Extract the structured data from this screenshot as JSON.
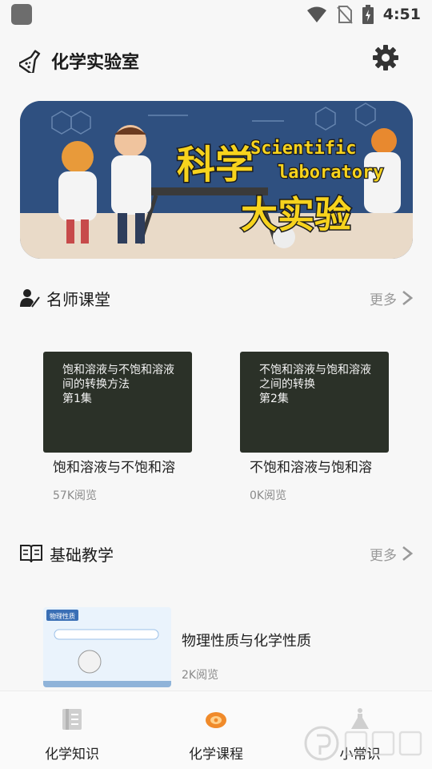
{
  "status_bar": {
    "time": "4:51"
  },
  "header": {
    "title": "化学实验室",
    "logo_icon": "flask-icon",
    "settings_icon": "gear-icon"
  },
  "banner": {
    "line1": "科学",
    "line2": "大实验",
    "en_line1": "Scientific",
    "en_line2": "laboratory"
  },
  "teacher_section": {
    "title": "名师课堂",
    "more": "更多",
    "videos": [
      {
        "thumb_text": "饱和溶液与不饱和溶液间的转换方法",
        "thumb_episode": "第1集",
        "title": "饱和溶液与不饱和溶",
        "views": "57K阅览"
      },
      {
        "thumb_text": "不饱和溶液与饱和溶液之间的转换",
        "thumb_episode": "第2集",
        "title": "不饱和溶液与饱和溶",
        "views": "0K阅览"
      }
    ]
  },
  "basic_section": {
    "title": "基础教学",
    "more": "更多",
    "lessons": [
      {
        "thumb_label": "物理性质",
        "title": "物理性质与化学性质",
        "views": "2K阅览"
      }
    ]
  },
  "bottom_nav": [
    {
      "label": "化学知识",
      "icon": "book-icon"
    },
    {
      "label": "化学课程",
      "icon": "course-icon"
    },
    {
      "label": "小常识",
      "icon": "flask-icon"
    }
  ]
}
